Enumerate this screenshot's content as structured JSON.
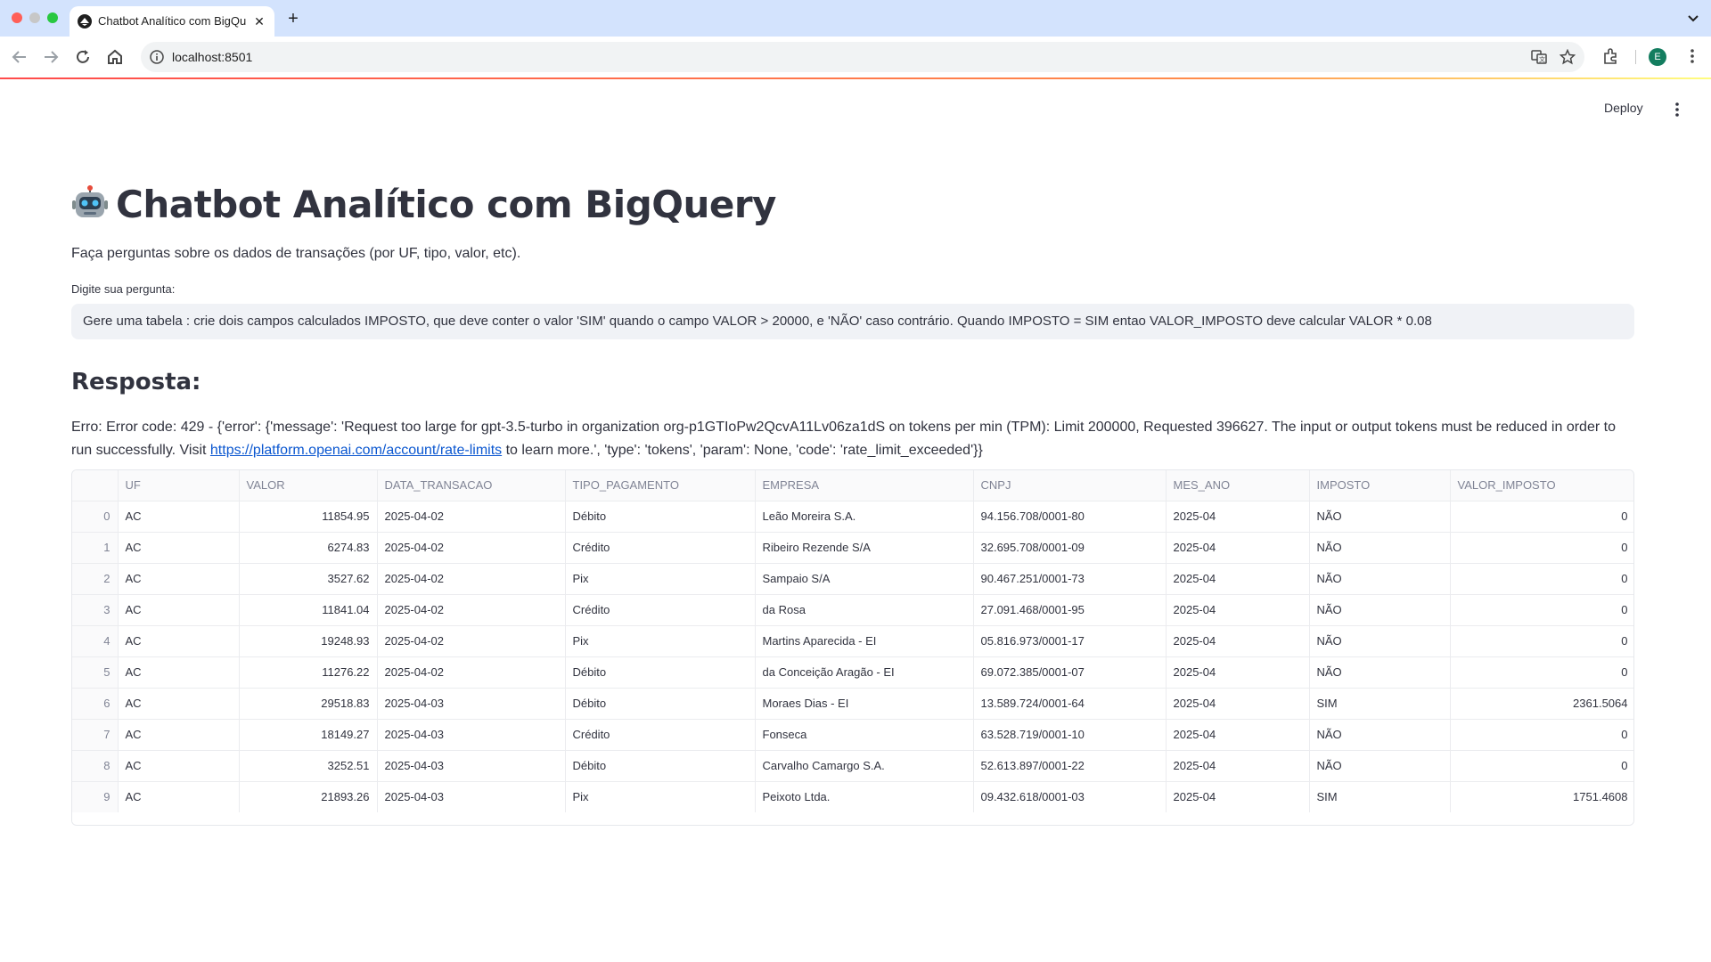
{
  "browser": {
    "tab_title": "Chatbot Analítico com BigQuery",
    "url": "localhost:8501",
    "profile_initial": "E"
  },
  "header": {
    "deploy_label": "Deploy"
  },
  "page": {
    "title": "Chatbot Analítico com BigQuery",
    "subtitle": "Faça perguntas sobre os dados de transações (por UF, tipo, valor, etc).",
    "input_label": "Digite sua pergunta:",
    "input_value": "Gere uma tabela : crie dois campos calculados IMPOSTO, que deve conter o valor 'SIM' quando o campo VALOR > 20000, e 'NÃO' caso contrário. Quando IMPOSTO = SIM entao VALOR_IMPOSTO deve calcular VALOR * 0.08",
    "response_heading": "Resposta:",
    "error_text": "Erro: Error code: 429 - {'error': {'message': 'Request too large for gpt-3.5-turbo in organization org-p1GTIoPw2QcvA11Lv06za1dS on tokens per min (TPM): Limit 200000, Requested 396627. The input or output tokens must be reduced in order to run successfully. Visit ",
    "error_link": "https://platform.openai.com/account/rate-limits",
    "error_tail": " to learn more.', 'type': 'tokens', 'param': None, 'code': 'rate_limit_exceeded'}}"
  },
  "table": {
    "columns": [
      "UF",
      "VALOR",
      "DATA_TRANSACAO",
      "TIPO_PAGAMENTO",
      "EMPRESA",
      "CNPJ",
      "MES_ANO",
      "IMPOSTO",
      "VALOR_IMPOSTO"
    ],
    "rows": [
      [
        "0",
        "AC",
        "11854.95",
        "2025-04-02",
        "Débito",
        "Leão Moreira S.A.",
        "94.156.708/0001-80",
        "2025-04",
        "NÃO",
        "0"
      ],
      [
        "1",
        "AC",
        "6274.83",
        "2025-04-02",
        "Crédito",
        "Ribeiro Rezende S/A",
        "32.695.708/0001-09",
        "2025-04",
        "NÃO",
        "0"
      ],
      [
        "2",
        "AC",
        "3527.62",
        "2025-04-02",
        "Pix",
        "Sampaio S/A",
        "90.467.251/0001-73",
        "2025-04",
        "NÃO",
        "0"
      ],
      [
        "3",
        "AC",
        "11841.04",
        "2025-04-02",
        "Crédito",
        "da Rosa",
        "27.091.468/0001-95",
        "2025-04",
        "NÃO",
        "0"
      ],
      [
        "4",
        "AC",
        "19248.93",
        "2025-04-02",
        "Pix",
        "Martins Aparecida - EI",
        "05.816.973/0001-17",
        "2025-04",
        "NÃO",
        "0"
      ],
      [
        "5",
        "AC",
        "11276.22",
        "2025-04-02",
        "Débito",
        "da Conceição Aragão - EI",
        "69.072.385/0001-07",
        "2025-04",
        "NÃO",
        "0"
      ],
      [
        "6",
        "AC",
        "29518.83",
        "2025-04-03",
        "Débito",
        "Moraes Dias - EI",
        "13.589.724/0001-64",
        "2025-04",
        "SIM",
        "2361.5064"
      ],
      [
        "7",
        "AC",
        "18149.27",
        "2025-04-03",
        "Crédito",
        "Fonseca",
        "63.528.719/0001-10",
        "2025-04",
        "NÃO",
        "0"
      ],
      [
        "8",
        "AC",
        "3252.51",
        "2025-04-03",
        "Débito",
        "Carvalho Camargo S.A.",
        "52.613.897/0001-22",
        "2025-04",
        "NÃO",
        "0"
      ],
      [
        "9",
        "AC",
        "21893.26",
        "2025-04-03",
        "Pix",
        "Peixoto Ltda.",
        "09.432.618/0001-03",
        "2025-04",
        "SIM",
        "1751.4608"
      ]
    ]
  },
  "colors": {
    "accent_red": "#ff4b4b",
    "link_blue": "#0b57d0",
    "input_bg": "#f0f2f6"
  },
  "icons": {
    "title_emoji": "robot-icon",
    "favicon": "streamlit-icon"
  }
}
